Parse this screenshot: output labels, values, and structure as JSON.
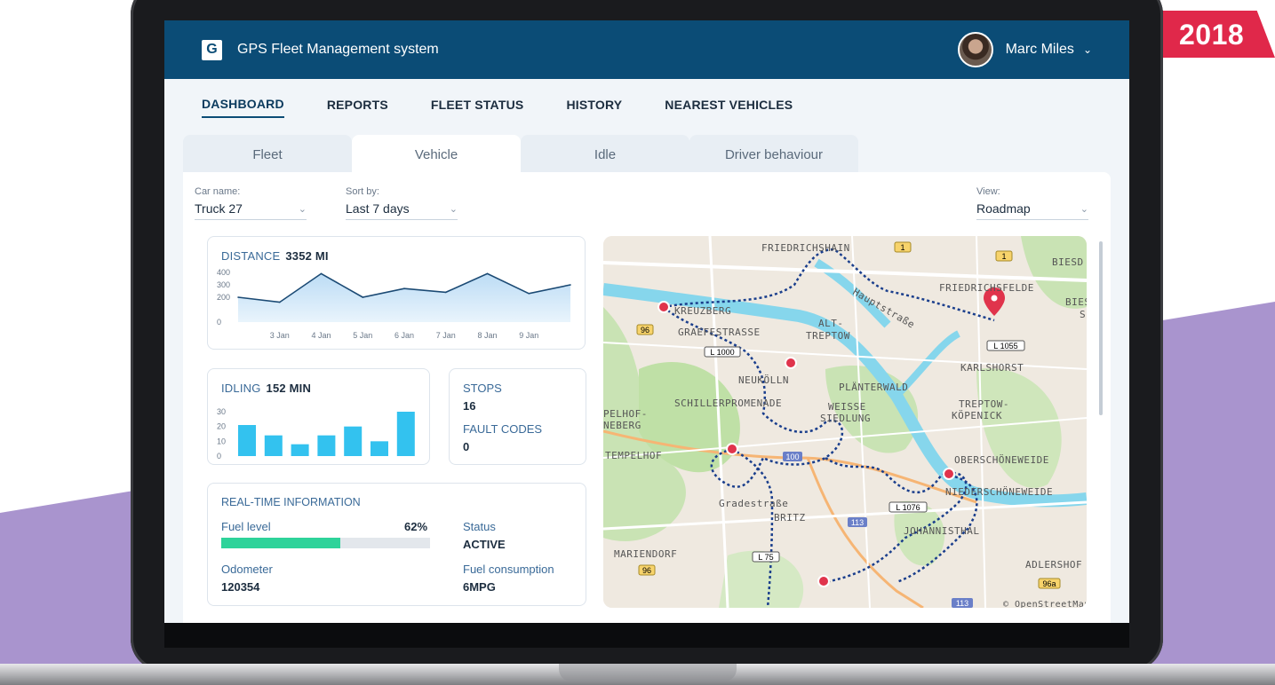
{
  "badge": "2018",
  "app": {
    "logo_letter": "G",
    "title": "GPS Fleet Management system",
    "user_name": "Marc Miles"
  },
  "nav": {
    "items": [
      "DASHBOARD",
      "REPORTS",
      "FLEET STATUS",
      "HISTORY",
      "NEAREST VEHICLES"
    ],
    "active": "DASHBOARD"
  },
  "tabs": {
    "items": [
      "Fleet",
      "Vehicle",
      "Idle",
      "Driver behaviour"
    ],
    "active": "Vehicle"
  },
  "filters": {
    "car_name": {
      "label": "Car name:",
      "value": "Truck 27"
    },
    "sort_by": {
      "label": "Sort by:",
      "value": "Last 7 days"
    },
    "view": {
      "label": "View:",
      "value": "Roadmap"
    }
  },
  "distance": {
    "label": "DISTANCE",
    "value": "3352 MI",
    "chart_data": {
      "type": "area",
      "categories": [
        "",
        "3 Jan",
        "4 Jan",
        "5 Jan",
        "6 Jan",
        "7 Jan",
        "8 Jan",
        "9 Jan",
        ""
      ],
      "values": [
        200,
        160,
        390,
        200,
        270,
        240,
        390,
        230,
        300
      ],
      "yticks": [
        0,
        200,
        300,
        400
      ],
      "ylim": [
        0,
        400
      ]
    }
  },
  "idling": {
    "label": "IDLING",
    "value": "152 MIN",
    "chart_data": {
      "type": "bar",
      "values": [
        21,
        14,
        8,
        14,
        20,
        10,
        30
      ],
      "yticks": [
        0,
        10,
        20,
        30
      ],
      "ylim": [
        0,
        30
      ]
    }
  },
  "stops": {
    "label": "STOPS",
    "value": "16"
  },
  "fault_codes": {
    "label": "FAULT CODES",
    "value": "0"
  },
  "realtime": {
    "title": "REAL-TIME INFORMATION",
    "fuel_level_label": "Fuel level",
    "fuel_level_value": "62%",
    "fuel_level_fraction": 0.57,
    "status_label": "Status",
    "status_value": "ACTIVE",
    "odometer_label": "Odometer",
    "odometer_value": "120354",
    "fuel_consumption_label": "Fuel consumption",
    "fuel_consumption_value": "6MPG"
  },
  "map": {
    "labels": [
      "FRIEDRICHSHAIN",
      "BIESD",
      "FRIEDRICHSFELDE",
      "BIES",
      "S",
      "Hauptstraße",
      "KREUZBERG",
      "GRAEFESTRASSE",
      "ALT-",
      "TREPTOW",
      "KARLSHORST",
      "NEUKÖLLN",
      "PLÄNTERWALD",
      "SCHILLERPROMENADE",
      "WEISSE",
      "SIEDLUNG",
      "PELHOF-",
      "NEBERG",
      "TREPTOW-",
      "KÖPENICK",
      "TEMPELHOF",
      "OBERSCHÖNEWEIDE",
      "NIEDERSCHÖNEWEIDE",
      "Gradestraße",
      "BRITZ",
      "JOHANNISTHAL",
      "MARIENDORF",
      "ADLERSHOF",
      "© OpenStreetMap"
    ],
    "shields": [
      "1",
      "1",
      "96",
      "L 1000",
      "L 1055",
      "100",
      "L 1076",
      "113",
      "L 75",
      "96",
      "96a",
      "113"
    ]
  },
  "colors": {
    "topbar": "#0b4c76",
    "accent_bar": "#33c2ef",
    "fuel_bar": "#2ed39a",
    "route": "#1a3e8c",
    "marker": "#e0344c"
  }
}
